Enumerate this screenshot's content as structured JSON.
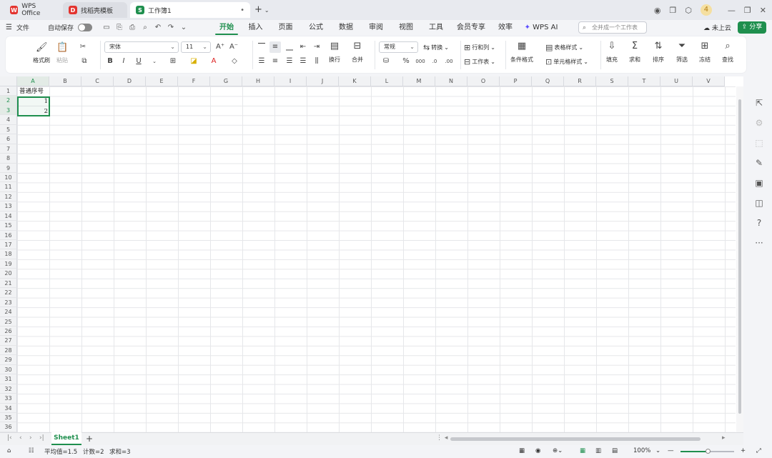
{
  "titlebar": {
    "tabs": [
      {
        "label": "WPS Office",
        "logo": "W",
        "logo_color": "#e3342f"
      },
      {
        "label": "找稻壳模板",
        "logo": "D",
        "logo_color": "#e3342f"
      },
      {
        "label": "工作簿1",
        "logo": "S",
        "logo_color": "#1f8f4e"
      }
    ],
    "new_tab": "+"
  },
  "menubar": {
    "file": "文件",
    "autosave": "自动保存",
    "tabs": [
      "开始",
      "插入",
      "页面",
      "公式",
      "数据",
      "审阅",
      "视图",
      "工具",
      "会员专享",
      "效率",
      "WPS AI"
    ],
    "active_tab": "开始",
    "search_placeholder": "全并成一个工作表",
    "cloud": "未上云",
    "share": "分享"
  },
  "ribbon": {
    "format_painter": "格式刷",
    "paste": "粘贴",
    "font_name": "宋体",
    "font_size": "11",
    "wrap": "换行",
    "merge": "合并",
    "number_format": "常规",
    "convert": "转换",
    "rows_cols": "行和列",
    "worksheet": "工作表",
    "conditional_format": "条件格式",
    "table_style": "表格样式",
    "cell_style": "单元格样式",
    "fill": "填充",
    "sum": "求和",
    "sort": "排序",
    "filter": "筛选",
    "freeze": "冻结",
    "find": "查找"
  },
  "sheet": {
    "columns": [
      "A",
      "B",
      "C",
      "D",
      "E",
      "F",
      "G",
      "H",
      "I",
      "J",
      "K",
      "L",
      "M",
      "N",
      "O",
      "P",
      "Q",
      "R",
      "S",
      "T",
      "U",
      "V"
    ],
    "rows": [
      "1",
      "2",
      "3",
      "4",
      "5",
      "6",
      "7",
      "8",
      "9",
      "10",
      "11",
      "12",
      "13",
      "14",
      "15",
      "16",
      "17",
      "18",
      "19",
      "20",
      "21",
      "22",
      "23",
      "24",
      "25",
      "26",
      "27",
      "28",
      "29",
      "30",
      "31",
      "32",
      "33",
      "34",
      "35",
      "36"
    ],
    "cells": {
      "A1": "普通序号",
      "A2": "1",
      "A3": "2"
    }
  },
  "tabbar": {
    "sheet_name": "Sheet1",
    "add": "+"
  },
  "statusbar": {
    "average": "平均值=1.5",
    "count": "计数=2",
    "sum": "求和=3",
    "zoom": "100%"
  },
  "colors": {
    "accent": "#1f8f4e"
  }
}
